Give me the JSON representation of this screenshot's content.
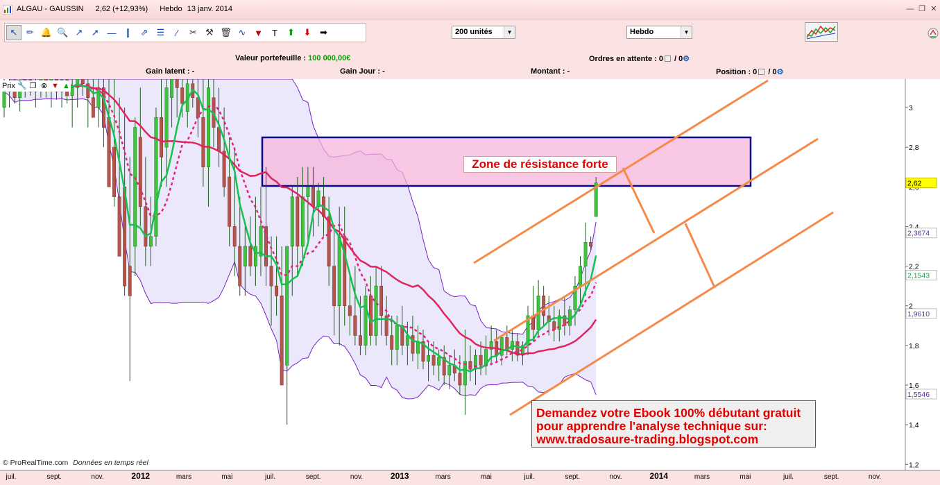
{
  "window": {
    "symbol": "ALGAU - GAUSSIN",
    "quote": "2,62 (+12,93%)",
    "period": "Hebdo",
    "date": "13 janv. 2014"
  },
  "toolbar": {
    "units_select": "200 unités",
    "period_select": "Hebdo",
    "tools": [
      "cursor-icon",
      "ruler-icon",
      "alarm-bell-icon",
      "zoom-icon",
      "segment-icon",
      "line-icon",
      "horizontal-line-icon",
      "vertical-line-icon",
      "channel-icon",
      "fibonacci-icon",
      "parallel-lines-icon",
      "scissors-icon",
      "wrench-icon",
      "trash-icon",
      "zigzag-icon",
      "fan-icon",
      "text-icon",
      "buy-arrow-icon",
      "sell-arrow-icon",
      "right-arrow-icon"
    ]
  },
  "portfolio": {
    "value_label": "Valeur portefeuille :",
    "value": "100 000,00€",
    "pending_label": "Ordres en attente : 0",
    "pending_sep": "/ 0",
    "latent_label": "Gain latent : -",
    "day_label": "Gain Jour : -",
    "amount_label": "Montant : -",
    "position_label": "Position : 0",
    "position_sep": "/ 0"
  },
  "prix_label": "Prix",
  "annotations": {
    "zone": "Zone de résistance forte",
    "ebook_lines": [
      "Demandez votre Ebook 100% débutant gratuit",
      " pour apprendre  l'analyse technique sur:",
      " www.tradosaure-trading.blogspot.com"
    ]
  },
  "footer": {
    "source": "© ProRealTime.com",
    "note": "Données en temps réel"
  },
  "chart_data": {
    "type": "candlestick",
    "frequency": "weekly",
    "y_axis": {
      "ticks": [
        1.2,
        1.4,
        1.6,
        1.8,
        2,
        2.2,
        2.4,
        2.6,
        2.8,
        3
      ],
      "tick_labels": [
        "1,2",
        "1,4",
        "1,6",
        "1,8",
        "2",
        "2,2",
        "2,4",
        "2,6",
        "2,8",
        "3"
      ],
      "range": [
        1.18,
        3.18
      ]
    },
    "x_axis": {
      "labels": [
        "juil.",
        "sept.",
        "nov.",
        "2012",
        "mars",
        "mai",
        "juil.",
        "sept.",
        "nov.",
        "2013",
        "mars",
        "mai",
        "juil.",
        "sept.",
        "nov.",
        "2014",
        "mars",
        "mai",
        "juil.",
        "sept.",
        "nov."
      ],
      "bold": [
        "2012",
        "2013",
        "2014"
      ]
    },
    "value_tags": [
      {
        "value": "2,62",
        "color": "#000000",
        "bg": "#ffff00"
      },
      {
        "value": "2,3674",
        "color": "#5b2aa8",
        "bg": "#ffffff"
      },
      {
        "value": "2,1543",
        "color": "#18a040",
        "bg": "#ffffff"
      },
      {
        "value": "1,9610",
        "color": "#5b2aa8",
        "bg": "#ffffff"
      },
      {
        "value": "1,5546",
        "color": "#5b2aa8",
        "bg": "#ffffff"
      }
    ],
    "last_price": 2.62,
    "ohlc": [
      [
        3.0,
        3.15,
        2.95,
        3.08
      ],
      [
        3.08,
        3.18,
        3.0,
        3.12
      ],
      [
        3.12,
        3.18,
        3.02,
        3.05
      ],
      [
        3.05,
        3.15,
        2.98,
        3.1
      ],
      [
        3.1,
        3.18,
        3.05,
        3.14
      ],
      [
        3.14,
        3.18,
        3.06,
        3.08
      ],
      [
        3.08,
        3.16,
        3.0,
        3.12
      ],
      [
        3.12,
        3.18,
        3.05,
        3.15
      ],
      [
        3.15,
        3.18,
        3.05,
        3.1
      ],
      [
        3.1,
        3.18,
        3.0,
        3.16
      ],
      [
        3.16,
        3.18,
        3.04,
        3.08
      ],
      [
        3.08,
        3.18,
        3.0,
        3.14
      ],
      [
        3.14,
        3.18,
        3.02,
        3.06
      ],
      [
        3.06,
        3.18,
        2.9,
        3.1
      ],
      [
        3.1,
        3.18,
        3.0,
        3.15
      ],
      [
        3.15,
        3.18,
        3.06,
        3.12
      ],
      [
        3.12,
        3.18,
        2.9,
        3.05
      ],
      [
        3.05,
        3.18,
        2.95,
        2.95
      ],
      [
        3.0,
        3.18,
        2.9,
        3.1
      ],
      [
        3.1,
        3.18,
        2.8,
        2.9
      ],
      [
        2.95,
        3.18,
        2.6,
        2.6
      ],
      [
        2.8,
        3.18,
        2.5,
        2.55
      ],
      [
        2.55,
        3.05,
        2.25,
        2.25
      ],
      [
        2.6,
        3.0,
        2.05,
        2.1
      ],
      [
        2.2,
        2.75,
        1.62,
        2.05
      ],
      [
        2.3,
        2.95,
        2.15,
        2.9
      ],
      [
        2.85,
        3.1,
        2.4,
        2.5
      ],
      [
        2.5,
        2.75,
        2.2,
        2.3
      ],
      [
        2.3,
        2.55,
        2.2,
        2.35
      ],
      [
        2.35,
        3.0,
        2.3,
        2.95
      ],
      [
        2.95,
        3.15,
        2.6,
        2.75
      ],
      [
        2.8,
        3.18,
        2.6,
        3.1
      ],
      [
        3.05,
        3.18,
        2.9,
        3.15
      ],
      [
        3.15,
        3.18,
        2.95,
        3.1
      ],
      [
        3.1,
        3.18,
        2.95,
        3.02
      ],
      [
        2.98,
        3.18,
        2.9,
        3.12
      ],
      [
        3.12,
        3.18,
        3.0,
        3.05
      ],
      [
        3.05,
        3.18,
        2.85,
        2.95
      ],
      [
        2.95,
        3.18,
        2.6,
        2.7
      ],
      [
        2.7,
        3.18,
        2.5,
        3.1
      ],
      [
        3.05,
        3.18,
        2.8,
        2.9
      ],
      [
        2.9,
        3.1,
        2.7,
        2.78
      ],
      [
        2.78,
        3.0,
        2.55,
        2.6
      ],
      [
        2.65,
        2.85,
        2.3,
        2.4
      ],
      [
        2.4,
        2.8,
        2.15,
        2.3
      ],
      [
        2.3,
        2.55,
        2.05,
        2.1
      ],
      [
        2.2,
        2.4,
        2.05,
        2.3
      ],
      [
        2.3,
        2.45,
        2.15,
        2.2
      ],
      [
        2.2,
        2.55,
        2.1,
        2.3
      ],
      [
        2.25,
        2.6,
        2.15,
        2.4
      ],
      [
        2.4,
        2.7,
        2.1,
        2.2
      ],
      [
        2.2,
        2.35,
        1.9,
        2.1
      ],
      [
        2.1,
        2.35,
        1.95,
        2.05
      ],
      [
        2.05,
        2.3,
        1.6,
        1.6
      ],
      [
        1.7,
        2.3,
        1.4,
        2.3
      ],
      [
        2.3,
        2.6,
        2.05,
        2.55
      ],
      [
        2.55,
        2.65,
        2.15,
        2.3
      ],
      [
        2.3,
        2.7,
        2.2,
        2.55
      ],
      [
        2.55,
        2.7,
        2.3,
        2.6
      ],
      [
        2.6,
        2.7,
        2.35,
        2.5
      ],
      [
        2.5,
        2.62,
        2.4,
        2.58
      ],
      [
        2.55,
        2.65,
        2.35,
        2.45
      ],
      [
        2.45,
        2.55,
        2.1,
        2.2
      ],
      [
        2.2,
        2.4,
        1.85,
        2.0
      ],
      [
        2.0,
        2.5,
        1.8,
        2.35
      ],
      [
        2.35,
        2.5,
        1.9,
        2.0
      ],
      [
        2.0,
        2.15,
        1.85,
        1.95
      ],
      [
        1.95,
        2.2,
        1.8,
        1.85
      ],
      [
        1.85,
        2.05,
        1.75,
        1.8
      ],
      [
        1.8,
        2.1,
        1.75,
        2.05
      ],
      [
        2.05,
        2.15,
        1.8,
        1.85
      ],
      [
        1.85,
        2.2,
        1.8,
        2.1
      ],
      [
        2.1,
        2.2,
        1.85,
        1.95
      ],
      [
        1.95,
        2.05,
        1.8,
        1.85
      ],
      [
        1.85,
        1.95,
        1.7,
        1.78
      ],
      [
        1.78,
        1.95,
        1.7,
        1.9
      ],
      [
        1.9,
        2.0,
        1.75,
        1.8
      ],
      [
        1.8,
        1.92,
        1.7,
        1.85
      ],
      [
        1.85,
        1.95,
        1.72,
        1.76
      ],
      [
        1.76,
        1.9,
        1.68,
        1.82
      ],
      [
        1.82,
        1.88,
        1.68,
        1.72
      ],
      [
        1.72,
        1.82,
        1.62,
        1.75
      ],
      [
        1.75,
        1.82,
        1.65,
        1.7
      ],
      [
        1.7,
        1.78,
        1.62,
        1.74
      ],
      [
        1.74,
        1.8,
        1.6,
        1.65
      ],
      [
        1.65,
        1.75,
        1.58,
        1.7
      ],
      [
        1.7,
        1.78,
        1.62,
        1.66
      ],
      [
        1.66,
        1.75,
        1.55,
        1.6
      ],
      [
        1.6,
        1.88,
        1.45,
        1.72
      ],
      [
        1.72,
        1.8,
        1.62,
        1.68
      ],
      [
        1.68,
        1.78,
        1.6,
        1.75
      ],
      [
        1.75,
        1.82,
        1.65,
        1.7
      ],
      [
        1.7,
        1.85,
        1.65,
        1.78
      ],
      [
        1.78,
        1.9,
        1.7,
        1.82
      ],
      [
        1.82,
        1.88,
        1.72,
        1.75
      ],
      [
        1.75,
        1.85,
        1.7,
        1.84
      ],
      [
        1.84,
        1.9,
        1.75,
        1.78
      ],
      [
        1.78,
        1.88,
        1.72,
        1.82
      ],
      [
        1.82,
        1.86,
        1.72,
        1.75
      ],
      [
        1.75,
        1.82,
        1.7,
        1.8
      ],
      [
        1.8,
        2.0,
        1.75,
        1.95
      ],
      [
        1.95,
        2.1,
        1.82,
        1.88
      ],
      [
        1.88,
        2.13,
        1.85,
        2.05
      ],
      [
        2.05,
        2.1,
        1.9,
        1.95
      ],
      [
        1.95,
        2.05,
        1.85,
        1.92
      ],
      [
        1.92,
        2.0,
        1.82,
        1.88
      ],
      [
        1.88,
        1.98,
        1.82,
        1.95
      ],
      [
        1.95,
        2.05,
        1.85,
        1.9
      ],
      [
        1.9,
        2.0,
        1.85,
        1.98
      ],
      [
        1.98,
        2.15,
        1.9,
        2.1
      ],
      [
        2.1,
        2.25,
        2.0,
        2.2
      ],
      [
        2.2,
        2.42,
        2.05,
        2.32
      ],
      [
        2.32,
        2.35,
        2.28,
        2.3
      ],
      [
        2.45,
        2.65,
        2.45,
        2.62
      ]
    ],
    "indicators": [
      {
        "name": "Bollinger",
        "color": "#7a1fc4"
      },
      {
        "name": "MA-long",
        "color": "#e0245e"
      },
      {
        "name": "MA-medium",
        "color": "#e0247e"
      },
      {
        "name": "MA-short",
        "color": "#18c050"
      }
    ]
  }
}
